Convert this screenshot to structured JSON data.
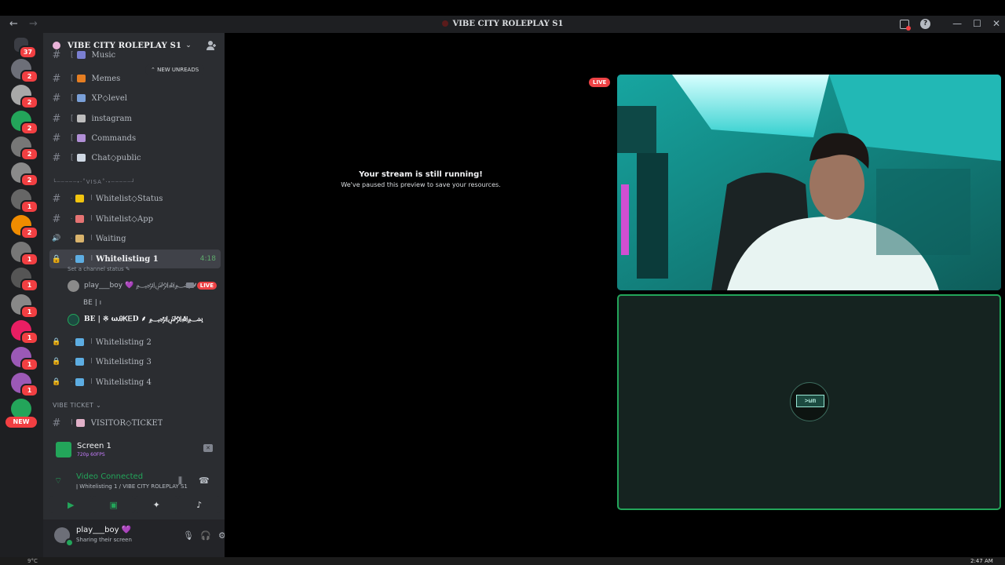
{
  "window": {
    "title": "VIBE CITY ROLEPLAY S1",
    "back_icon": "←",
    "forward_icon": "→",
    "minimize": "—",
    "maximize": "☐",
    "close": "✕",
    "help": "?"
  },
  "rail": {
    "home_badge": "37",
    "servers": [
      {
        "badge": "2",
        "color": "#6d6f78"
      },
      {
        "badge": "2",
        "color": "#a8a8a8"
      },
      {
        "badge": "2",
        "color": "#23a55a"
      },
      {
        "badge": "2",
        "color": "#777"
      },
      {
        "badge": "2",
        "color": "#8a8a8a"
      },
      {
        "badge": "1",
        "color": "#666"
      },
      {
        "badge": "2",
        "color": "#f08c00"
      },
      {
        "badge": "1",
        "color": "#777"
      },
      {
        "badge": "1",
        "color": "#555"
      },
      {
        "badge": "1",
        "color": "#888"
      },
      {
        "badge": "1",
        "color": "#e91e63"
      },
      {
        "badge": "1",
        "color": "#9b59b6"
      },
      {
        "badge": "1",
        "color": "#9b59b6"
      },
      {
        "badge": "",
        "color": "#23a55a"
      }
    ],
    "new_label": "NEW"
  },
  "sidebar": {
    "server_name": "VIBE CITY ROLEPLAY S1",
    "new_unreads": "NEW UNREADS",
    "channels_top": [
      {
        "name": "Music",
        "emoji_color": "#7a7fd1"
      },
      {
        "name": "Memes",
        "emoji_color": "#e67e22"
      },
      {
        "name": "XP◇level",
        "emoji_color": "#7aa0d8"
      },
      {
        "name": "instagram",
        "emoji_color": "#bdbdbd"
      },
      {
        "name": "Commands",
        "emoji_color": "#b18fd6"
      },
      {
        "name": "Chat◇public",
        "emoji_color": "#cfd8e3"
      }
    ],
    "divider": "╰┈┈┈┈┈˖·˚VISA˚·˖┈┈┈┈┈╯",
    "channels_mid": [
      {
        "name": "Whitelist◇Status",
        "emoji_color": "#f1c40f",
        "type": "text"
      },
      {
        "name": "Whitelist◇App",
        "emoji_color": "#e57373",
        "type": "text"
      },
      {
        "name": "Waiting",
        "emoji_color": "#d9b36c",
        "type": "voice"
      }
    ],
    "active_channel": {
      "name": "Whitelisting 1",
      "timer": "4:18",
      "status_prompt": "Set a channel status"
    },
    "voice_users": [
      {
        "name": "play___boy 💜 ﷽ ⸙",
        "live": "LIVE"
      },
      {
        "name": "BE | ı"
      },
      {
        "name": "BE | ※ ωᎯᏦᎬD ⸙ ﷽"
      }
    ],
    "channels_locked": [
      {
        "name": "Whitelisting 2"
      },
      {
        "name": "Whitelisting 3"
      },
      {
        "name": "Whitelisting 4"
      }
    ],
    "category": "VIBE TICKET",
    "ticket_channel": {
      "name": "VISITOR◇TICKET"
    }
  },
  "screen_share": {
    "title": "Screen 1",
    "quality": "720p 60FPS"
  },
  "voice": {
    "status": "Video Connected",
    "location": "ǀ Whitelisting 1 / VIBE CITY ROLEPLAY S1"
  },
  "user": {
    "name": "play___boy 💜",
    "status": "Sharing their screen"
  },
  "main": {
    "paused_title": "Your stream is still running!",
    "paused_sub": "We've paused this preview to save your resources.",
    "live": "LIVE",
    "avatar_text": ">ωm"
  },
  "taskbar": {
    "temp": "9°C",
    "clock": "2:47 AM"
  },
  "colors": {
    "accent_green": "#23a55a",
    "live_red": "#ed4245",
    "sidebar_bg": "#2b2d31",
    "rail_bg": "#1e1f22"
  }
}
